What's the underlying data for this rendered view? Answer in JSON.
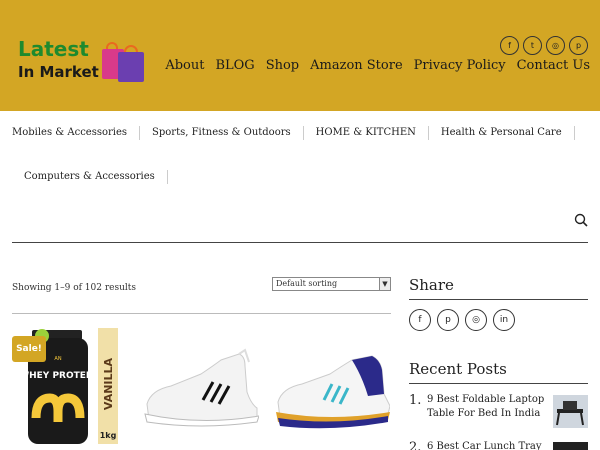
{
  "header": {
    "logo_line1": "Latest",
    "logo_line2": "In Market",
    "social": [
      {
        "icon": "facebook-icon",
        "glyph": "f"
      },
      {
        "icon": "twitter-icon",
        "glyph": "t"
      },
      {
        "icon": "instagram-icon",
        "glyph": "◎"
      },
      {
        "icon": "pinterest-icon",
        "glyph": "p"
      }
    ],
    "nav": [
      "About",
      "BLOG",
      "Shop",
      "Amazon Store",
      "Privacy Policy",
      "Contact Us"
    ],
    "bg_color": "#d3a624"
  },
  "categories": {
    "row1": [
      "Mobiles & Accessories",
      "Sports, Fitness & Outdoors",
      "HOME & KITCHEN",
      "Health & Personal Care"
    ],
    "row2": [
      "Computers & Accessories"
    ]
  },
  "shop": {
    "result_count": "Showing 1–9 of 102 results",
    "sort_selected": "Default sorting",
    "sale_badge": "Sale!",
    "products": [
      {
        "name": "whey-protein",
        "image_text_main": "WHEY PROTEIN",
        "image_text_side": "VANILLA",
        "image_text_weight": "1kg"
      },
      {
        "name": "white-adidas-shoe"
      },
      {
        "name": "blue-white-adidas-shoe"
      }
    ]
  },
  "sidebar": {
    "share_title": "Share",
    "share_icons": [
      {
        "icon": "facebook-icon",
        "glyph": "f"
      },
      {
        "icon": "pinterest-icon",
        "glyph": "p"
      },
      {
        "icon": "instagram-icon",
        "glyph": "◎"
      },
      {
        "icon": "linkedin-icon",
        "glyph": "in"
      }
    ],
    "recent_title": "Recent Posts",
    "recent_posts": [
      {
        "num": "1.",
        "title": "9 Best Foldable Laptop Table For Bed In India"
      },
      {
        "num": "2.",
        "title": "6 Best Car Lunch Tray"
      }
    ]
  }
}
